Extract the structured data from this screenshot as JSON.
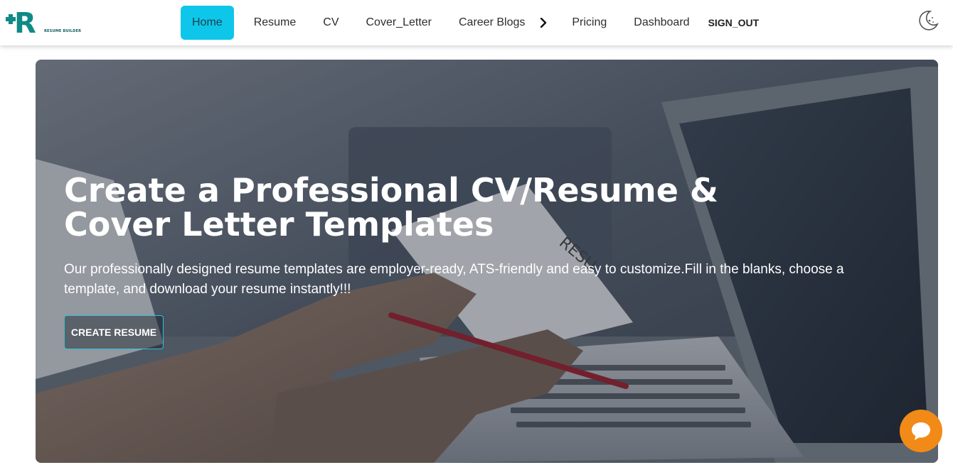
{
  "brand": {
    "logo_letter": "R",
    "logo_caption": "RESUME BUILDER",
    "accent": "#0ec6ea",
    "logo_color": "#0f8a86"
  },
  "nav": {
    "items": [
      {
        "label": "Home",
        "active": true
      },
      {
        "label": "Resume"
      },
      {
        "label": "CV"
      },
      {
        "label": "Cover_Letter"
      },
      {
        "label": "Career Blogs"
      },
      {
        "label": "Pricing"
      },
      {
        "label": "Dashboard"
      },
      {
        "label": "SIGN_OUT"
      }
    ],
    "more_icon": "chevron-right-icon",
    "theme_icon": "moon-icon"
  },
  "hero": {
    "title": "Create a Professional CV/Resume & Cover Letter Templates",
    "subtitle": "Our professionally designed resume templates are employer-ready, ATS-friendly and easy to customize.Fill in the blanks, choose a template, and download your resume instantly!!!",
    "cta_label": "CREATE RESUME",
    "image_text": "RESU",
    "cta_border_color": "#2bc4dc"
  },
  "chat": {
    "icon": "chat-bubble-icon",
    "color": "#f28a17"
  }
}
